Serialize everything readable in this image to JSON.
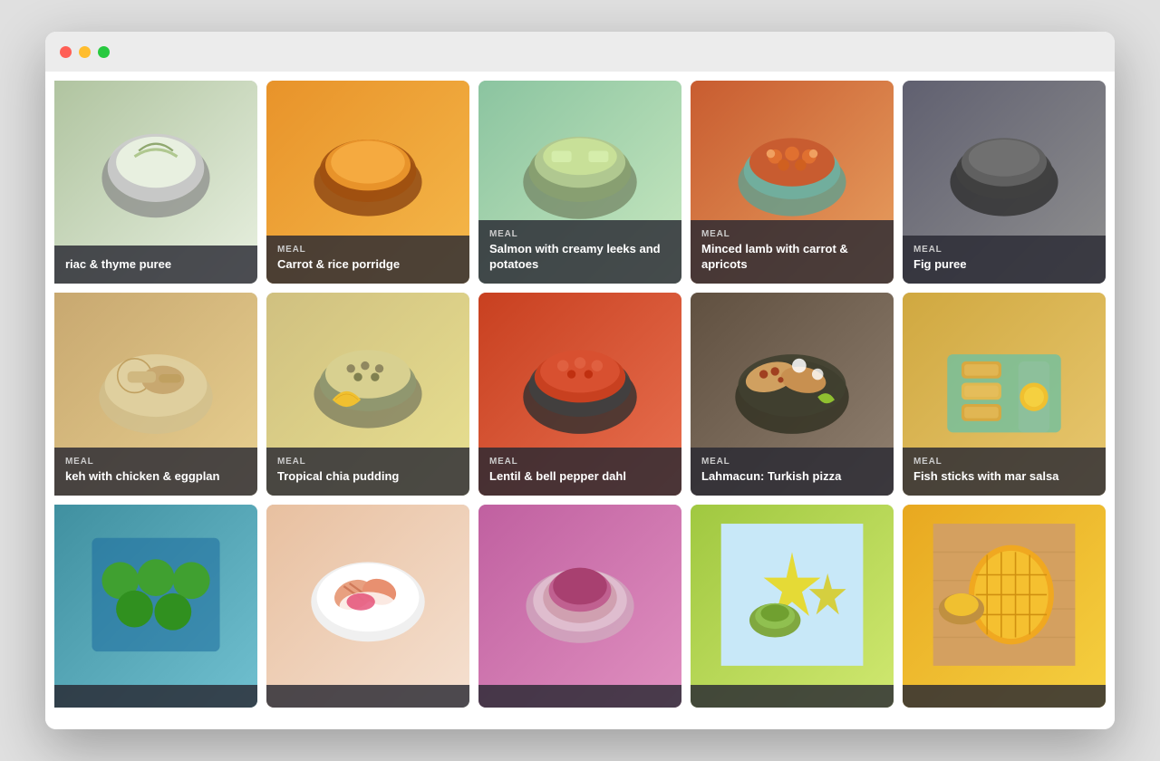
{
  "window": {
    "traffic_lights": [
      "close",
      "minimize",
      "maximize"
    ]
  },
  "grid": {
    "rows": [
      [
        {
          "id": "celeriac",
          "label": "MEAL",
          "title": "riac & thyme puree",
          "partial": true,
          "bg": "bg-celeriac",
          "food_color": "#d4e8c0",
          "bowl_color": "#555"
        },
        {
          "id": "carrot-rice",
          "label": "MEAL",
          "title": "Carrot & rice porridge",
          "partial": false,
          "bg": "bg-carrot",
          "food_color": "#e8932a",
          "bowl_color": "#8B4513"
        },
        {
          "id": "salmon",
          "label": "MEAL",
          "title": "Salmon with creamy leeks and potatoes",
          "partial": false,
          "bg": "bg-salmon",
          "food_color": "#90c090",
          "bowl_color": "#708060"
        },
        {
          "id": "lamb",
          "label": "MEAL",
          "title": "Minced lamb with carrot & apricots",
          "partial": false,
          "bg": "bg-lamb",
          "food_color": "#c85c30",
          "bowl_color": "#60a090"
        },
        {
          "id": "fig",
          "label": "MEAL",
          "title": "Fig puree",
          "partial": false,
          "bg": "bg-fig",
          "food_color": "#606060",
          "bowl_color": "#404040"
        }
      ],
      [
        {
          "id": "chicken-eggplan",
          "label": "MEAL",
          "title": "keh with chicken & eggplan",
          "partial": true,
          "bg": "bg-chicken",
          "food_color": "#c8a870",
          "bowl_color": "#d0c090"
        },
        {
          "id": "chia",
          "label": "MEAL",
          "title": "Tropical chia pudding",
          "partial": false,
          "bg": "bg-chia",
          "food_color": "#d8c878",
          "bowl_color": "#808060"
        },
        {
          "id": "lentil",
          "label": "MEAL",
          "title": "Lentil & bell pepper dahl",
          "partial": false,
          "bg": "bg-lentil",
          "food_color": "#c84020",
          "bowl_color": "#404040"
        },
        {
          "id": "lahmacun",
          "label": "MEAL",
          "title": "Lahmacun: Turkish pizza",
          "partial": false,
          "bg": "bg-lahmacun",
          "food_color": "#907060",
          "bowl_color": "#404030"
        },
        {
          "id": "fishsticks",
          "label": "MEAL",
          "title": "Fish sticks with mar salsa",
          "partial": false,
          "bg": "bg-fishsticks",
          "food_color": "#d8a840",
          "bowl_color": "#90c0a0"
        }
      ],
      [
        {
          "id": "green-bites",
          "label": "",
          "title": "",
          "partial": true,
          "bg": "bg-green",
          "food_color": "#4090a0",
          "bowl_color": "#2070a0"
        },
        {
          "id": "peach-dessert",
          "label": "",
          "title": "",
          "partial": false,
          "bg": "bg-peach",
          "food_color": "#e8c0a0",
          "bowl_color": "#f0e0d0"
        },
        {
          "id": "beet-puree",
          "label": "",
          "title": "",
          "partial": false,
          "bg": "bg-beet",
          "food_color": "#c060a0",
          "bowl_color": "#d0a0c0"
        },
        {
          "id": "starfruit",
          "label": "",
          "title": "",
          "partial": false,
          "bg": "bg-starfruit",
          "food_color": "#a0c840",
          "bowl_color": "#80a020"
        },
        {
          "id": "mango",
          "label": "",
          "title": "",
          "partial": false,
          "bg": "bg-mango",
          "food_color": "#e8a820",
          "bowl_color": "#f5d040"
        }
      ]
    ]
  }
}
